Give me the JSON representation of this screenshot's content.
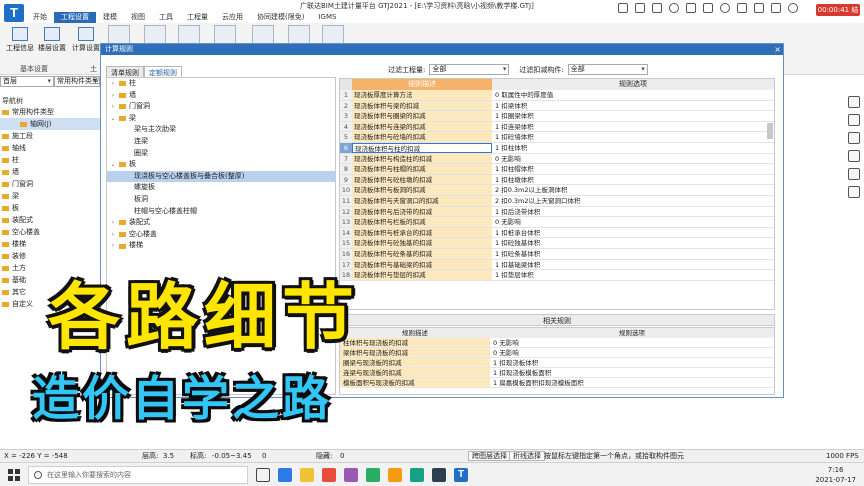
{
  "window": {
    "title": "广联达BIM土建计量平台 GTJ2021 - [E:\\学习资料\\亮晗\\小视频\\教学楼.GTJ]",
    "logo": "T",
    "record_time": "00:00:41 结束"
  },
  "ribbon_tabs": [
    "开始",
    "工程设置",
    "建模",
    "视图",
    "工具",
    "工程量",
    "云应用",
    "协同建模(限免)",
    "IGMS"
  ],
  "ribbon": {
    "buttons": [
      "工程信息",
      "楼层设置",
      "计算设置"
    ],
    "group_labels": [
      "基本设置",
      "土"
    ]
  },
  "left": {
    "layer_select": "首层",
    "type_select": "常用构件类型",
    "nav_title": "导航树",
    "nav_items": [
      "常用构件类型",
      "轴网(J)",
      "施工段",
      "轴线",
      "柱",
      "墙",
      "门窗洞",
      "梁",
      "板",
      "装配式",
      "空心楼盖",
      "楼梯",
      "装修",
      "土方",
      "基础",
      "其它",
      "自定义"
    ]
  },
  "dialog": {
    "title": "计算规则",
    "close": "×",
    "tabs": [
      "清单规则",
      "定额规则"
    ],
    "tree_items": [
      {
        "label": "柱",
        "exp": "›",
        "indent": 0,
        "folder": true
      },
      {
        "label": "墙",
        "exp": "›",
        "indent": 0,
        "folder": true
      },
      {
        "label": "门窗洞",
        "exp": "›",
        "indent": 0,
        "folder": true
      },
      {
        "label": "梁",
        "exp": "⌄",
        "indent": 0,
        "folder": true
      },
      {
        "label": "梁与主次肋梁",
        "exp": "",
        "indent": 1,
        "folder": false
      },
      {
        "label": "连梁",
        "exp": "",
        "indent": 1,
        "folder": false
      },
      {
        "label": "圈梁",
        "exp": "",
        "indent": 1,
        "folder": false
      },
      {
        "label": "板",
        "exp": "⌄",
        "indent": 0,
        "folder": true
      },
      {
        "label": "现浇板与空心楼盖板与叠合板(整厚)",
        "exp": "",
        "indent": 1,
        "folder": false
      },
      {
        "label": "螺旋板",
        "exp": "",
        "indent": 1,
        "folder": false
      },
      {
        "label": "板洞",
        "exp": "",
        "indent": 1,
        "folder": false
      },
      {
        "label": "柱帽与空心楼盖柱帽",
        "exp": "",
        "indent": 1,
        "folder": false
      },
      {
        "label": "装配式",
        "exp": "›",
        "indent": 0,
        "folder": true
      },
      {
        "label": "空心楼盖",
        "exp": "›",
        "indent": 0,
        "folder": true
      },
      {
        "label": "楼梯",
        "exp": "›",
        "indent": 0,
        "folder": true
      }
    ],
    "filter_qty_label": "过滤工程量:",
    "filter_qty_value": "全部",
    "filter_comp_label": "过滤扣减构件:",
    "filter_comp_value": "全部",
    "rules_header_desc": "规则描述",
    "rules_header_opt": "规则选项",
    "rules": [
      {
        "n": "1",
        "desc": "现浇板厚度计算方法",
        "opt": "0  取属性中的厚度值"
      },
      {
        "n": "2",
        "desc": "现浇板体积与梁的扣减",
        "opt": "1  扣梁体积"
      },
      {
        "n": "3",
        "desc": "现浇板体积与圈梁的扣减",
        "opt": "1  扣圈梁体积"
      },
      {
        "n": "4",
        "desc": "现浇板体积与连梁的扣减",
        "opt": "1  扣连梁体积"
      },
      {
        "n": "5",
        "desc": "现浇板体积与砼墙的扣减",
        "opt": "1  扣砼墙体积"
      },
      {
        "n": "6",
        "desc": "现浇板体积与柱的扣减",
        "opt": "1  扣柱体积"
      },
      {
        "n": "7",
        "desc": "现浇板体积与构造柱的扣减",
        "opt": "0  无影响"
      },
      {
        "n": "8",
        "desc": "现浇板体积与柱帽的扣减",
        "opt": "1  扣柱帽体积"
      },
      {
        "n": "9",
        "desc": "现浇板体积与砼柱墩的扣减",
        "opt": "1  扣柱墩体积"
      },
      {
        "n": "10",
        "desc": "现浇板体积与板洞的扣减",
        "opt": "2  扣0.3m2以上板洞体积"
      },
      {
        "n": "11",
        "desc": "现浇板体积与天窗洞口的扣减",
        "opt": "2  扣0.3m2以上天窗洞口体积"
      },
      {
        "n": "12",
        "desc": "现浇板体积与后浇带的扣减",
        "opt": "1  扣后浇带体积"
      },
      {
        "n": "13",
        "desc": "现浇板体积与栏板的扣减",
        "opt": "0  无影响"
      },
      {
        "n": "14",
        "desc": "现浇板体积与桩承台的扣减",
        "opt": "1  扣桩承台体积"
      },
      {
        "n": "15",
        "desc": "现浇板体积与砼独基的扣减",
        "opt": "1  扣砼独基体积"
      },
      {
        "n": "16",
        "desc": "现浇板体积与砼条基的扣减",
        "opt": "1  扣砼条基体积"
      },
      {
        "n": "17",
        "desc": "现浇板体积与基础梁的扣减",
        "opt": "1  扣基础梁体积"
      },
      {
        "n": "18",
        "desc": "现浇板体积与垫层的扣减",
        "opt": "1  扣垫层体积"
      }
    ],
    "related_title": "相关规则",
    "related_header_desc": "规则描述",
    "related_header_opt": "规则选项",
    "related_rules": [
      {
        "desc": "柱体积与现浇板的扣减",
        "opt": "0  无影响"
      },
      {
        "desc": "梁体积与现浇板的扣减",
        "opt": "0  无影响"
      },
      {
        "desc": "圈梁与现浇板的扣减",
        "opt": "1  扣现浇板体积"
      },
      {
        "desc": "连梁与现浇板的扣减",
        "opt": "1  扣现浇板模板面积"
      },
      {
        "desc": "模板面积与现浇板的扣减",
        "opt": "1  扁嘉模板面积扣现浇模板面积"
      }
    ]
  },
  "overlay": {
    "line1": "各路细节",
    "line2": "造价自学之路"
  },
  "statusbar": {
    "coords": "X = -226 Y = -548",
    "floor_height": "层高:",
    "floor_height_val": "3.5",
    "elevation": "标高:",
    "elevation_val": "-0.05~3.45",
    "zero": "0",
    "hidden": "隐藏:",
    "hidden_val": "0",
    "btn_cross": "跨图层选择",
    "btn_fold": "折线选择",
    "hint": "按鼠标左键指定第一个角点，或拾取构件图元",
    "fps": "1000 FPS"
  },
  "taskbar": {
    "search_placeholder": "在这里输入你要搜索的内容",
    "time": "7:16",
    "date": "2021-07-17"
  }
}
